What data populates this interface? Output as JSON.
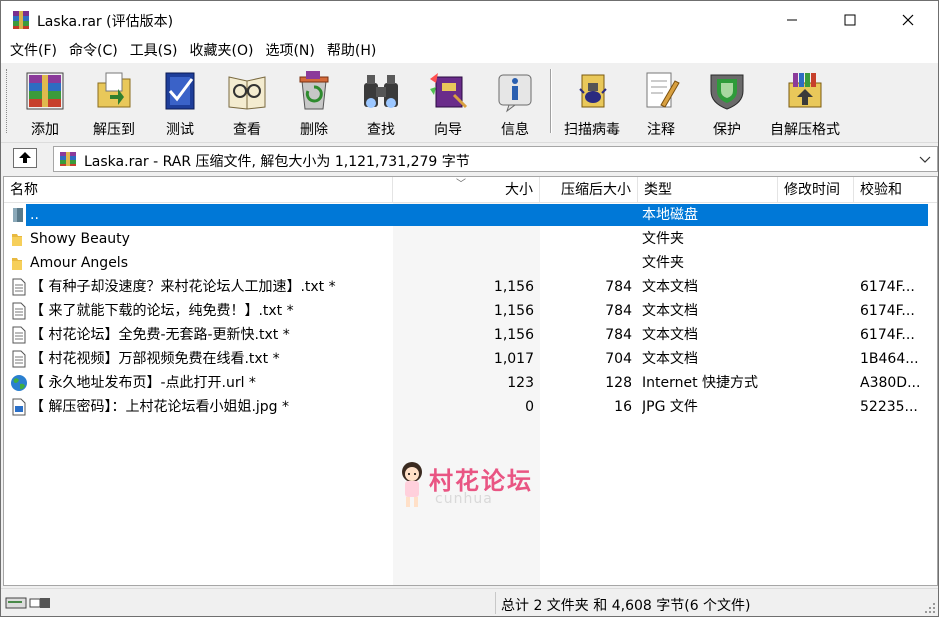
{
  "window": {
    "title": "Laska.rar (评估版本)"
  },
  "menu": [
    "文件(F)",
    "命令(C)",
    "工具(S)",
    "收藏夹(O)",
    "选项(N)",
    "帮助(H)"
  ],
  "toolbar": {
    "buttons": [
      {
        "label": "添加",
        "icon": "add-archive-icon"
      },
      {
        "label": "解压到",
        "icon": "extract-to-icon"
      },
      {
        "label": "测试",
        "icon": "test-icon"
      },
      {
        "label": "查看",
        "icon": "view-icon"
      },
      {
        "label": "删除",
        "icon": "delete-icon"
      },
      {
        "label": "查找",
        "icon": "find-icon"
      },
      {
        "label": "向导",
        "icon": "wizard-icon"
      },
      {
        "label": "信息",
        "icon": "info-icon"
      },
      {
        "label": "扫描病毒",
        "icon": "virus-scan-icon"
      },
      {
        "label": "注释",
        "icon": "comment-icon"
      },
      {
        "label": "保护",
        "icon": "protect-icon"
      },
      {
        "label": "自解压格式",
        "icon": "sfx-icon"
      }
    ]
  },
  "address": {
    "text": "Laska.rar - RAR 压缩文件, 解包大小为 1,121,731,279 字节"
  },
  "columns": {
    "name": "名称",
    "size": "大小",
    "packed": "压缩后大小",
    "type": "类型",
    "modified": "修改时间",
    "crc": "校验和"
  },
  "files": [
    {
      "name": "..",
      "size": "",
      "packed": "",
      "type": "本地磁盘",
      "modified": "",
      "crc": "",
      "icon": "drive-icon",
      "selected": true
    },
    {
      "name": "Showy Beauty",
      "size": "",
      "packed": "",
      "type": "文件夹",
      "modified": "",
      "crc": "",
      "icon": "folder-icon",
      "selected": false
    },
    {
      "name": "Amour Angels",
      "size": "",
      "packed": "",
      "type": "文件夹",
      "modified": "",
      "crc": "",
      "icon": "folder-icon",
      "selected": false
    },
    {
      "name": "【 有种子却没速度？来村花论坛人工加速】.txt *",
      "size": "1,156",
      "packed": "784",
      "type": "文本文档",
      "modified": "",
      "crc": "6174F...",
      "icon": "text-file-icon",
      "selected": false
    },
    {
      "name": "【 来了就能下载的论坛，纯免费！】.txt *",
      "size": "1,156",
      "packed": "784",
      "type": "文本文档",
      "modified": "",
      "crc": "6174F...",
      "icon": "text-file-icon",
      "selected": false
    },
    {
      "name": "【 村花论坛】全免费-无套路-更新快.txt *",
      "size": "1,156",
      "packed": "784",
      "type": "文本文档",
      "modified": "",
      "crc": "6174F...",
      "icon": "text-file-icon",
      "selected": false
    },
    {
      "name": "【 村花视频】万部视频免费在线看.txt *",
      "size": "1,017",
      "packed": "704",
      "type": "文本文档",
      "modified": "",
      "crc": "1B464...",
      "icon": "text-file-icon",
      "selected": false
    },
    {
      "name": "【 永久地址发布页】-点此打开.url *",
      "size": "123",
      "packed": "128",
      "type": "Internet 快捷方式",
      "modified": "",
      "crc": "A380D...",
      "icon": "globe-icon",
      "selected": false
    },
    {
      "name": "【 解压密码】：上村花论坛看小姐姐.jpg *",
      "size": "0",
      "packed": "16",
      "type": "JPG 文件",
      "modified": "",
      "crc": "52235...",
      "icon": "image-file-icon",
      "selected": false
    }
  ],
  "watermark": {
    "text": "村花论坛",
    "subtext": "cunhua"
  },
  "status": {
    "text": "总计 2 文件夹 和 4,608 字节(6 个文件)"
  },
  "colors": {
    "selection": "#0078d7",
    "watermark": "#e8487a"
  }
}
